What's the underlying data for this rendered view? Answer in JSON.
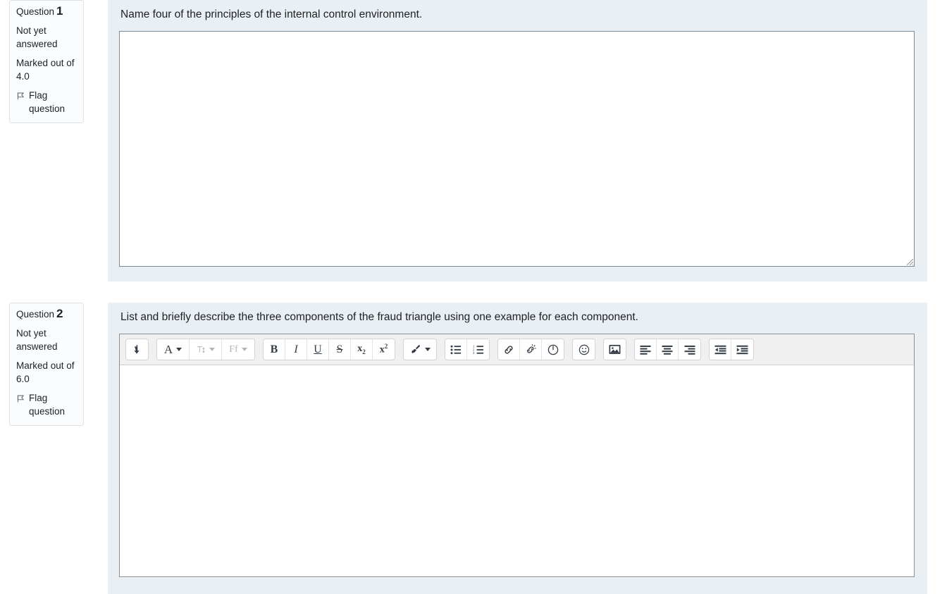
{
  "questions": [
    {
      "info": {
        "label": "Question",
        "number": "1",
        "state": "Not yet answered",
        "grade": "Marked out of 4.0",
        "flag_label": "Flag question"
      },
      "text": "Name four of the principles of the internal control environment.",
      "answer_value": "",
      "answer_placeholder": "",
      "editor_type": "plain"
    },
    {
      "info": {
        "label": "Question",
        "number": "2",
        "state": "Not yet answered",
        "grade": "Marked out of 6.0",
        "flag_label": "Flag question"
      },
      "text": "List and briefly describe the three components of the fraud triangle using one example for each component.",
      "answer_value": "",
      "answer_placeholder": "",
      "editor_type": "rich"
    }
  ],
  "editor_toolbar": {
    "groups": [
      {
        "name": "collapse",
        "buttons": [
          {
            "id": "expand-toolbar",
            "icon": "down-arrow-icon",
            "label": "",
            "title": "Show more buttons",
            "disabled": false,
            "caret": false
          }
        ]
      },
      {
        "name": "styles",
        "buttons": [
          {
            "id": "paragraph-style",
            "icon": "letter-a-icon",
            "label": "A",
            "title": "Paragraph styles",
            "disabled": false,
            "caret": true
          },
          {
            "id": "font-size",
            "icon": "font-size-icon",
            "label": "T",
            "title": "Font size",
            "disabled": true,
            "caret": true
          },
          {
            "id": "font-family",
            "icon": "font-family-icon",
            "label": "Ff",
            "title": "Font family",
            "disabled": true,
            "caret": true
          }
        ]
      },
      {
        "name": "inline-format",
        "buttons": [
          {
            "id": "bold",
            "icon": "bold-icon",
            "label": "B",
            "title": "Bold",
            "disabled": false,
            "caret": false
          },
          {
            "id": "italic",
            "icon": "italic-icon",
            "label": "I",
            "title": "Italic",
            "disabled": false,
            "caret": false
          },
          {
            "id": "underline",
            "icon": "underline-icon",
            "label": "U",
            "title": "Underline",
            "disabled": false,
            "caret": false
          },
          {
            "id": "strikethrough",
            "icon": "strikethrough-icon",
            "label": "S",
            "title": "Strikethrough",
            "disabled": false,
            "caret": false
          },
          {
            "id": "subscript",
            "icon": "subscript-icon",
            "label": "x",
            "title": "Subscript",
            "disabled": false,
            "caret": false
          },
          {
            "id": "superscript",
            "icon": "superscript-icon",
            "label": "x",
            "title": "Superscript",
            "disabled": false,
            "caret": false
          }
        ]
      },
      {
        "name": "color",
        "buttons": [
          {
            "id": "text-color",
            "icon": "paintbrush-icon",
            "label": "",
            "title": "Text colour",
            "disabled": false,
            "caret": true
          }
        ]
      },
      {
        "name": "lists",
        "buttons": [
          {
            "id": "unordered-list",
            "icon": "bullet-list-icon",
            "label": "",
            "title": "Unordered list",
            "disabled": false,
            "caret": false
          },
          {
            "id": "ordered-list",
            "icon": "numbered-list-icon",
            "label": "",
            "title": "Ordered list",
            "disabled": false,
            "caret": false
          }
        ]
      },
      {
        "name": "links",
        "buttons": [
          {
            "id": "insert-link",
            "icon": "link-icon",
            "label": "",
            "title": "Link",
            "disabled": false,
            "caret": false
          },
          {
            "id": "unlink",
            "icon": "unlink-icon",
            "label": "",
            "title": "Unlink",
            "disabled": false,
            "caret": false
          },
          {
            "id": "anchor",
            "icon": "anchor-icon",
            "label": "",
            "title": "Anchor",
            "disabled": false,
            "caret": false
          }
        ]
      },
      {
        "name": "emoji",
        "buttons": [
          {
            "id": "insert-emoticon",
            "icon": "smiley-icon",
            "label": "",
            "title": "Emoticon",
            "disabled": false,
            "caret": false
          }
        ]
      },
      {
        "name": "media",
        "buttons": [
          {
            "id": "insert-image",
            "icon": "image-icon",
            "label": "",
            "title": "Image",
            "disabled": false,
            "caret": false
          }
        ]
      },
      {
        "name": "align",
        "buttons": [
          {
            "id": "align-left",
            "icon": "align-left-icon",
            "label": "",
            "title": "Align left",
            "disabled": false,
            "caret": false
          },
          {
            "id": "align-center",
            "icon": "align-center-icon",
            "label": "",
            "title": "Align center",
            "disabled": false,
            "caret": false
          },
          {
            "id": "align-right",
            "icon": "align-right-icon",
            "label": "",
            "title": "Align right",
            "disabled": false,
            "caret": false
          }
        ]
      },
      {
        "name": "indent",
        "buttons": [
          {
            "id": "outdent",
            "icon": "outdent-icon",
            "label": "",
            "title": "Decrease indent",
            "disabled": false,
            "caret": false
          },
          {
            "id": "indent",
            "icon": "indent-icon",
            "label": "",
            "title": "Increase indent",
            "disabled": false,
            "caret": false
          }
        ]
      }
    ]
  },
  "colors": {
    "panel_bg": "#e9eff2",
    "page_bg": "#ffffff",
    "info_bg": "#fbfcfd",
    "info_border": "#dee2e6",
    "toolbar_bg": "#f0f0f0",
    "text": "#1d2125",
    "icon": "#343d46",
    "disabled": "#adb5bd",
    "editor_border": "#868e96"
  }
}
